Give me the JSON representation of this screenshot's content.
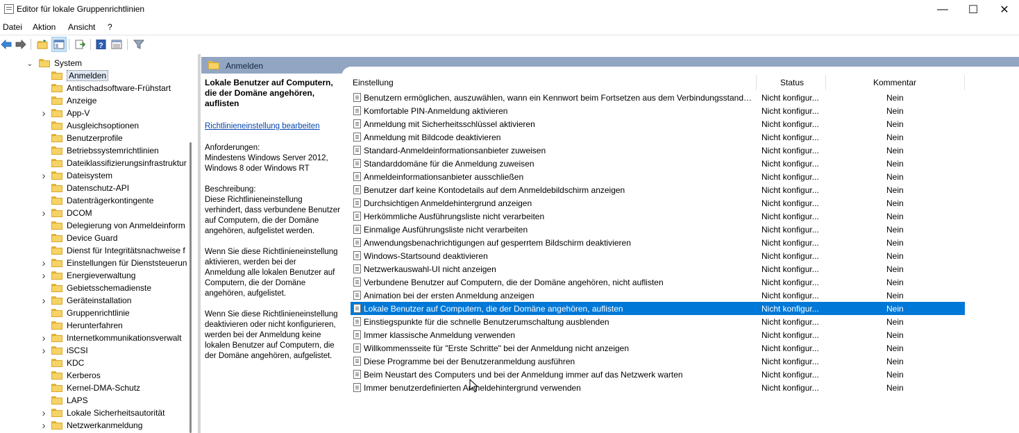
{
  "window": {
    "title": "Editor für lokale Gruppenrichtlinien",
    "minimize": "—",
    "maximize": "☐",
    "close": "✕"
  },
  "menu": [
    "Datei",
    "Aktion",
    "Ansicht",
    "?"
  ],
  "toolbar": [
    "back-arrow-icon",
    "forward-arrow-icon",
    "up-folder-icon",
    "show-hide-tree-icon",
    "export-list-icon",
    "help-icon",
    "properties-view-icon",
    "filter-icon"
  ],
  "tree": {
    "parent": "System",
    "items": [
      {
        "label": "Anmelden",
        "selected": true,
        "expandable": false
      },
      {
        "label": "Antischadsoftware-Frühstart",
        "expandable": false
      },
      {
        "label": "Anzeige",
        "expandable": false
      },
      {
        "label": "App-V",
        "expandable": true
      },
      {
        "label": "Ausgleichsoptionen",
        "expandable": false
      },
      {
        "label": "Benutzerprofile",
        "expandable": false
      },
      {
        "label": "Betriebssystemrichtlinien",
        "expandable": false
      },
      {
        "label": "Dateiklassifizierungsinfrastruktur",
        "expandable": false
      },
      {
        "label": "Dateisystem",
        "expandable": true
      },
      {
        "label": "Datenschutz-API",
        "expandable": false
      },
      {
        "label": "Datenträgerkontingente",
        "expandable": false
      },
      {
        "label": "DCOM",
        "expandable": true
      },
      {
        "label": "Delegierung von Anmeldeinform",
        "expandable": false
      },
      {
        "label": "Device Guard",
        "expandable": false
      },
      {
        "label": "Dienst für Integritätsnachweise f",
        "expandable": false
      },
      {
        "label": "Einstellungen für Dienststeuerun",
        "expandable": true
      },
      {
        "label": "Energieverwaltung",
        "expandable": true
      },
      {
        "label": "Gebietsschemadienste",
        "expandable": false
      },
      {
        "label": "Geräteinstallation",
        "expandable": true
      },
      {
        "label": "Gruppenrichtlinie",
        "expandable": false
      },
      {
        "label": "Herunterfahren",
        "expandable": false
      },
      {
        "label": "Internetkommunikationsverwalt",
        "expandable": true
      },
      {
        "label": "iSCSI",
        "expandable": true
      },
      {
        "label": "KDC",
        "expandable": false
      },
      {
        "label": "Kerberos",
        "expandable": false
      },
      {
        "label": "Kernel-DMA-Schutz",
        "expandable": false
      },
      {
        "label": "LAPS",
        "expandable": false
      },
      {
        "label": "Lokale Sicherheitsautorität",
        "expandable": true
      },
      {
        "label": "Netzwerkanmeldung",
        "expandable": true
      }
    ]
  },
  "header": {
    "title": "Anmelden"
  },
  "extended": {
    "title": "Lokale Benutzer auf Computern, die der Domäne angehören, auflisten",
    "link": "Richtlinieneinstellung bearbeiten",
    "requirements": "Anforderungen:\nMindestens Windows Server 2012,\nWindows 8 oder Windows RT",
    "description": "Beschreibung:\nDiese Richtlinieneinstellung\nverhindert, dass verbundene Benutzer\nauf Computern, die der Domäne\nangehören, aufgelistet werden.",
    "enabled_text": "Wenn Sie diese Richtlinieneinstellung\naktivieren, werden bei der\nAnmeldung alle lokalen Benutzer auf\nComputern, die der Domäne\nangehören, aufgelistet.",
    "disabled_text": "Wenn Sie diese Richtlinieneinstellung\ndeaktivieren oder nicht konfigurieren,\nwerden bei der Anmeldung keine\nlokalen Benutzer auf Computern, die\nder Domäne angehören, aufgelistet."
  },
  "list": {
    "columns": [
      "Einstellung",
      "Status",
      "Kommentar"
    ],
    "rows": [
      {
        "name": "Benutzern ermöglichen, auszuwählen, wann ein Kennwort beim Fortsetzen aus dem Verbindungsstandby ...",
        "status": "Nicht konfigur...",
        "comment": "Nein"
      },
      {
        "name": "Komfortable PIN-Anmeldung aktivieren",
        "status": "Nicht konfigur...",
        "comment": "Nein"
      },
      {
        "name": "Anmeldung mit Sicherheitsschlüssel aktivieren",
        "status": "Nicht konfigur...",
        "comment": "Nein"
      },
      {
        "name": "Anmeldung mit Bildcode deaktivieren",
        "status": "Nicht konfigur...",
        "comment": "Nein"
      },
      {
        "name": "Standard-Anmeldeinformationsanbieter zuweisen",
        "status": "Nicht konfigur...",
        "comment": "Nein"
      },
      {
        "name": "Standarddomäne für die Anmeldung zuweisen",
        "status": "Nicht konfigur...",
        "comment": "Nein"
      },
      {
        "name": "Anmeldeinformationsanbieter ausschließen",
        "status": "Nicht konfigur...",
        "comment": "Nein"
      },
      {
        "name": "Benutzer darf keine Kontodetails auf dem Anmeldebildschirm anzeigen",
        "status": "Nicht konfigur...",
        "comment": "Nein"
      },
      {
        "name": "Durchsichtigen Anmeldehintergrund anzeigen",
        "status": "Nicht konfigur...",
        "comment": "Nein"
      },
      {
        "name": "Herkömmliche Ausführungsliste nicht verarbeiten",
        "status": "Nicht konfigur...",
        "comment": "Nein"
      },
      {
        "name": "Einmalige Ausführungsliste nicht verarbeiten",
        "status": "Nicht konfigur...",
        "comment": "Nein"
      },
      {
        "name": "Anwendungsbenachrichtigungen auf gesperrtem Bildschirm deaktivieren",
        "status": "Nicht konfigur...",
        "comment": "Nein"
      },
      {
        "name": "Windows-Startsound deaktivieren",
        "status": "Nicht konfigur...",
        "comment": "Nein"
      },
      {
        "name": "Netzwerkauswahl-UI nicht anzeigen",
        "status": "Nicht konfigur...",
        "comment": "Nein"
      },
      {
        "name": "Verbundene Benutzer auf Computern, die der Domäne angehören, nicht auflisten",
        "status": "Nicht konfigur...",
        "comment": "Nein"
      },
      {
        "name": "Animation bei der ersten Anmeldung anzeigen",
        "status": "Nicht konfigur...",
        "comment": "Nein"
      },
      {
        "name": "Lokale Benutzer auf Computern, die der Domäne angehören, auflisten",
        "status": "Nicht konfigur...",
        "comment": "Nein",
        "selected": true
      },
      {
        "name": "Einstiegspunkte für die schnelle Benutzerumschaltung ausblenden",
        "status": "Nicht konfigur...",
        "comment": "Nein"
      },
      {
        "name": "Immer klassische Anmeldung verwenden",
        "status": "Nicht konfigur...",
        "comment": "Nein"
      },
      {
        "name": "Willkommensseite für \"Erste Schritte\" bei der Anmeldung nicht anzeigen",
        "status": "Nicht konfigur...",
        "comment": "Nein"
      },
      {
        "name": "Diese Programme bei der Benutzeranmeldung ausführen",
        "status": "Nicht konfigur...",
        "comment": "Nein"
      },
      {
        "name": "Beim Neustart des Computers und bei der Anmeldung immer auf das Netzwerk warten",
        "status": "Nicht konfigur...",
        "comment": "Nein"
      },
      {
        "name": "Immer benutzerdefinierten Anmeldehintergrund verwenden",
        "status": "Nicht konfigur...",
        "comment": "Nein"
      }
    ]
  }
}
